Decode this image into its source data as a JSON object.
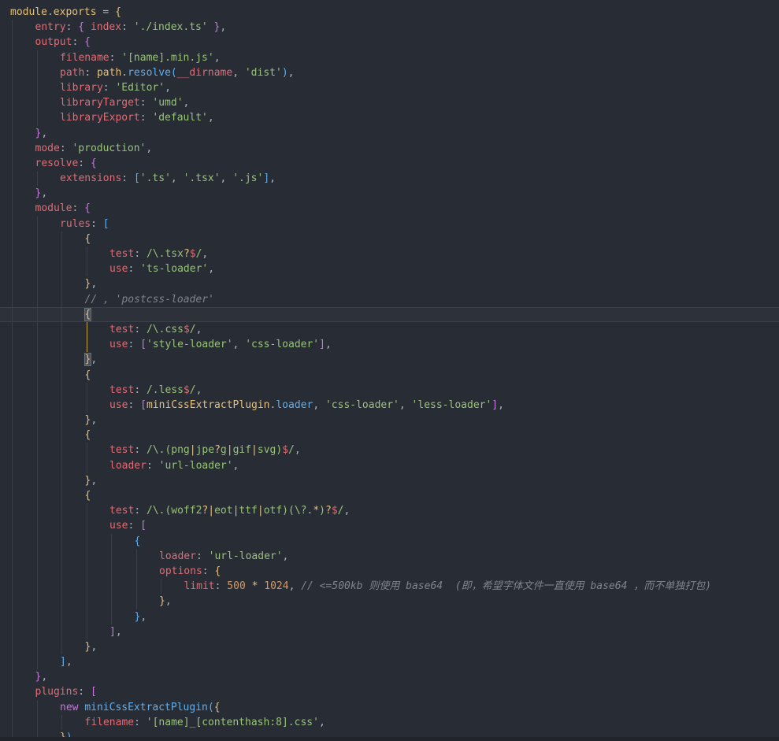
{
  "colors": {
    "background": "#282c34",
    "current_line": "#2c313a",
    "guide": "#3b4048",
    "active_guide": "#c8a43a"
  },
  "editor": {
    "lines": [
      {
        "indent": 0,
        "tokens": [
          [
            "module",
            "o"
          ],
          [
            ".",
            "p"
          ],
          [
            "exports",
            "o"
          ],
          [
            " = ",
            "p"
          ],
          [
            "{",
            "b1"
          ]
        ]
      },
      {
        "indent": 1,
        "tokens": [
          [
            "entry",
            "k"
          ],
          [
            ": ",
            "p"
          ],
          [
            "{ ",
            "b2"
          ],
          [
            "index",
            "k"
          ],
          [
            ": ",
            "p"
          ],
          [
            "'./index.ts'",
            "s"
          ],
          [
            " }",
            "b2"
          ],
          [
            ",",
            "p"
          ]
        ]
      },
      {
        "indent": 1,
        "tokens": [
          [
            "output",
            "k"
          ],
          [
            ": ",
            "p"
          ],
          [
            "{",
            "b2"
          ]
        ]
      },
      {
        "indent": 2,
        "tokens": [
          [
            "filename",
            "k"
          ],
          [
            ": ",
            "p"
          ],
          [
            "'[name].min.js'",
            "s"
          ],
          [
            ",",
            "p"
          ]
        ]
      },
      {
        "indent": 2,
        "tokens": [
          [
            "path",
            "k"
          ],
          [
            ": ",
            "p"
          ],
          [
            "path",
            "o"
          ],
          [
            ".",
            "p"
          ],
          [
            "resolve",
            "f"
          ],
          [
            "(",
            "b3"
          ],
          [
            "__dirname",
            "k"
          ],
          [
            ", ",
            "p"
          ],
          [
            "'dist'",
            "s"
          ],
          [
            ")",
            "b3"
          ],
          [
            ",",
            "p"
          ]
        ]
      },
      {
        "indent": 2,
        "tokens": [
          [
            "library",
            "k"
          ],
          [
            ": ",
            "p"
          ],
          [
            "'Editor'",
            "s"
          ],
          [
            ",",
            "p"
          ]
        ]
      },
      {
        "indent": 2,
        "tokens": [
          [
            "libraryTarget",
            "k"
          ],
          [
            ": ",
            "p"
          ],
          [
            "'umd'",
            "s"
          ],
          [
            ",",
            "p"
          ]
        ]
      },
      {
        "indent": 2,
        "tokens": [
          [
            "libraryExport",
            "k"
          ],
          [
            ": ",
            "p"
          ],
          [
            "'default'",
            "s"
          ],
          [
            ",",
            "p"
          ]
        ]
      },
      {
        "indent": 1,
        "tokens": [
          [
            "}",
            "b2"
          ],
          [
            ",",
            "p"
          ]
        ]
      },
      {
        "indent": 1,
        "tokens": [
          [
            "mode",
            "k"
          ],
          [
            ": ",
            "p"
          ],
          [
            "'production'",
            "s"
          ],
          [
            ",",
            "p"
          ]
        ]
      },
      {
        "indent": 1,
        "tokens": [
          [
            "resolve",
            "k"
          ],
          [
            ": ",
            "p"
          ],
          [
            "{",
            "b2"
          ]
        ]
      },
      {
        "indent": 2,
        "tokens": [
          [
            "extensions",
            "k"
          ],
          [
            ": ",
            "p"
          ],
          [
            "[",
            "b3"
          ],
          [
            "'.ts'",
            "s"
          ],
          [
            ", ",
            "p"
          ],
          [
            "'.tsx'",
            "s"
          ],
          [
            ", ",
            "p"
          ],
          [
            "'.js'",
            "s"
          ],
          [
            "]",
            "b3"
          ],
          [
            ",",
            "p"
          ]
        ]
      },
      {
        "indent": 1,
        "tokens": [
          [
            "}",
            "b2"
          ],
          [
            ",",
            "p"
          ]
        ]
      },
      {
        "indent": 1,
        "tokens": [
          [
            "module",
            "k"
          ],
          [
            ": ",
            "p"
          ],
          [
            "{",
            "b2"
          ]
        ]
      },
      {
        "indent": 2,
        "tokens": [
          [
            "rules",
            "k"
          ],
          [
            ": ",
            "p"
          ],
          [
            "[",
            "b3"
          ]
        ]
      },
      {
        "indent": 3,
        "tokens": [
          [
            "{",
            "b1"
          ]
        ]
      },
      {
        "indent": 4,
        "tokens": [
          [
            "test",
            "k"
          ],
          [
            ": ",
            "p"
          ],
          [
            "/\\.tsx",
            "s"
          ],
          [
            "?",
            "o"
          ],
          [
            "$",
            "k"
          ],
          [
            "/",
            "s"
          ],
          [
            ",",
            "p"
          ]
        ]
      },
      {
        "indent": 4,
        "tokens": [
          [
            "use",
            "k"
          ],
          [
            ": ",
            "p"
          ],
          [
            "'ts-loader'",
            "s"
          ],
          [
            ",",
            "p"
          ]
        ]
      },
      {
        "indent": 3,
        "tokens": [
          [
            "}",
            "b1"
          ],
          [
            ",",
            "p"
          ]
        ]
      },
      {
        "indent": 3,
        "tokens": [
          [
            "// , 'postcss-loader'",
            "c"
          ]
        ]
      },
      {
        "indent": 3,
        "current": true,
        "tokens": [
          [
            "{",
            "b1m"
          ]
        ]
      },
      {
        "indent": 4,
        "tokens": [
          [
            "test",
            "k"
          ],
          [
            ": ",
            "p"
          ],
          [
            "/\\.css",
            "s"
          ],
          [
            "$",
            "k"
          ],
          [
            "/",
            "s"
          ],
          [
            ",",
            "p"
          ]
        ]
      },
      {
        "indent": 4,
        "tokens": [
          [
            "use",
            "k"
          ],
          [
            ": ",
            "p"
          ],
          [
            "[",
            "b2"
          ],
          [
            "'style-loader'",
            "s"
          ],
          [
            ", ",
            "p"
          ],
          [
            "'css-loader'",
            "s"
          ],
          [
            "]",
            "b2"
          ],
          [
            ",",
            "p"
          ]
        ]
      },
      {
        "indent": 3,
        "tokens": [
          [
            "}",
            "b1m"
          ],
          [
            ",",
            "p"
          ]
        ]
      },
      {
        "indent": 3,
        "tokens": [
          [
            "{",
            "b1"
          ]
        ]
      },
      {
        "indent": 4,
        "tokens": [
          [
            "test",
            "k"
          ],
          [
            ": ",
            "p"
          ],
          [
            "/.less",
            "s"
          ],
          [
            "$",
            "k"
          ],
          [
            "/",
            "s"
          ],
          [
            ",",
            "p"
          ]
        ]
      },
      {
        "indent": 4,
        "tokens": [
          [
            "use",
            "k"
          ],
          [
            ": ",
            "p"
          ],
          [
            "[",
            "b2"
          ],
          [
            "miniCssExtractPlugin",
            "o"
          ],
          [
            ".",
            "p"
          ],
          [
            "loader",
            "f"
          ],
          [
            ", ",
            "p"
          ],
          [
            "'css-loader'",
            "s"
          ],
          [
            ", ",
            "p"
          ],
          [
            "'less-loader'",
            "s"
          ],
          [
            "]",
            "b2"
          ],
          [
            ",",
            "p"
          ]
        ]
      },
      {
        "indent": 3,
        "tokens": [
          [
            "}",
            "b1"
          ],
          [
            ",",
            "p"
          ]
        ]
      },
      {
        "indent": 3,
        "tokens": [
          [
            "{",
            "b1"
          ]
        ]
      },
      {
        "indent": 4,
        "tokens": [
          [
            "test",
            "k"
          ],
          [
            ": ",
            "p"
          ],
          [
            "/\\.(png",
            "s"
          ],
          [
            "|",
            "o"
          ],
          [
            "jpe",
            "s"
          ],
          [
            "?",
            "o"
          ],
          [
            "g",
            "s"
          ],
          [
            "|",
            "o"
          ],
          [
            "gif",
            "s"
          ],
          [
            "|",
            "o"
          ],
          [
            "svg)",
            "s"
          ],
          [
            "$",
            "k"
          ],
          [
            "/",
            "s"
          ],
          [
            ",",
            "p"
          ]
        ]
      },
      {
        "indent": 4,
        "tokens": [
          [
            "loader",
            "k"
          ],
          [
            ": ",
            "p"
          ],
          [
            "'url-loader'",
            "s"
          ],
          [
            ",",
            "p"
          ]
        ]
      },
      {
        "indent": 3,
        "tokens": [
          [
            "}",
            "b1"
          ],
          [
            ",",
            "p"
          ]
        ]
      },
      {
        "indent": 3,
        "tokens": [
          [
            "{",
            "b1"
          ]
        ]
      },
      {
        "indent": 4,
        "tokens": [
          [
            "test",
            "k"
          ],
          [
            ": ",
            "p"
          ],
          [
            "/\\.(woff2",
            "s"
          ],
          [
            "?",
            "o"
          ],
          [
            "|",
            "o"
          ],
          [
            "eot",
            "s"
          ],
          [
            "|",
            "o"
          ],
          [
            "ttf",
            "s"
          ],
          [
            "|",
            "o"
          ],
          [
            "otf)(\\?.",
            "s"
          ],
          [
            "*",
            "o"
          ],
          [
            ")",
            "s"
          ],
          [
            "?",
            "o"
          ],
          [
            "$",
            "k"
          ],
          [
            "/",
            "s"
          ],
          [
            ",",
            "p"
          ]
        ]
      },
      {
        "indent": 4,
        "tokens": [
          [
            "use",
            "k"
          ],
          [
            ": ",
            "p"
          ],
          [
            "[",
            "b2"
          ]
        ]
      },
      {
        "indent": 5,
        "tokens": [
          [
            "{",
            "b3"
          ]
        ]
      },
      {
        "indent": 6,
        "tokens": [
          [
            "loader",
            "k"
          ],
          [
            ": ",
            "p"
          ],
          [
            "'url-loader'",
            "s"
          ],
          [
            ",",
            "p"
          ]
        ]
      },
      {
        "indent": 6,
        "tokens": [
          [
            "options",
            "k"
          ],
          [
            ": ",
            "p"
          ],
          [
            "{",
            "b1"
          ]
        ]
      },
      {
        "indent": 7,
        "tokens": [
          [
            "limit",
            "k"
          ],
          [
            ": ",
            "p"
          ],
          [
            "500",
            "n"
          ],
          [
            " * ",
            "o"
          ],
          [
            "1024",
            "n"
          ],
          [
            ", ",
            "p"
          ],
          [
            "// <=500kb 则使用 base64  (即，希望字体文件一直使用 base64 ，而不单独打包)",
            "c"
          ]
        ]
      },
      {
        "indent": 6,
        "tokens": [
          [
            "}",
            "b1"
          ],
          [
            ",",
            "p"
          ]
        ]
      },
      {
        "indent": 5,
        "tokens": [
          [
            "}",
            "b3"
          ],
          [
            ",",
            "p"
          ]
        ]
      },
      {
        "indent": 4,
        "tokens": [
          [
            "]",
            "b2"
          ],
          [
            ",",
            "p"
          ]
        ]
      },
      {
        "indent": 3,
        "tokens": [
          [
            "}",
            "b1"
          ],
          [
            ",",
            "p"
          ]
        ]
      },
      {
        "indent": 2,
        "tokens": [
          [
            "]",
            "b3"
          ],
          [
            ",",
            "p"
          ]
        ]
      },
      {
        "indent": 1,
        "tokens": [
          [
            "}",
            "b2"
          ],
          [
            ",",
            "p"
          ]
        ]
      },
      {
        "indent": 1,
        "tokens": [
          [
            "plugins",
            "k"
          ],
          [
            ": ",
            "p"
          ],
          [
            "[",
            "b2"
          ]
        ]
      },
      {
        "indent": 2,
        "tokens": [
          [
            "new",
            "kw"
          ],
          [
            " ",
            "p"
          ],
          [
            "miniCssExtractPlugin",
            "f"
          ],
          [
            "(",
            "b3"
          ],
          [
            "{",
            "b1"
          ]
        ]
      },
      {
        "indent": 3,
        "tokens": [
          [
            "filename",
            "k"
          ],
          [
            ": ",
            "p"
          ],
          [
            "'[name]_[contenthash:8].css'",
            "s"
          ],
          [
            ",",
            "p"
          ]
        ]
      },
      {
        "indent": 2,
        "tokens": [
          [
            "}",
            "b1"
          ],
          [
            ")",
            "b3"
          ],
          [
            ",",
            "p"
          ]
        ]
      }
    ]
  }
}
